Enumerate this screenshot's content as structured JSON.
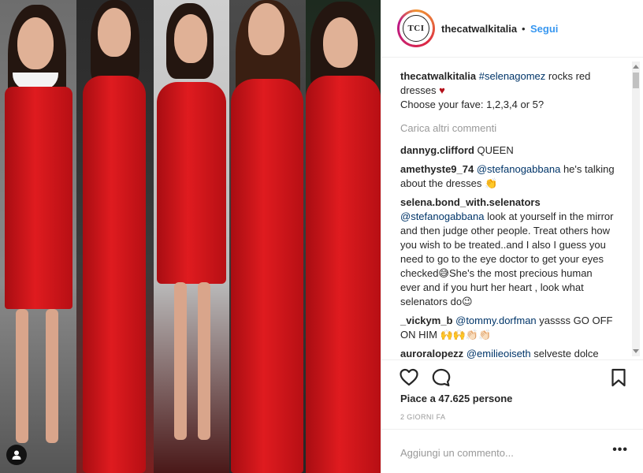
{
  "post": {
    "username": "thecatwalkitalia",
    "separator": "•",
    "follow_label": "Segui",
    "avatar_text": "TCI"
  },
  "caption": {
    "username": "thecatwalkitalia",
    "hashtag": "#selenagomez",
    "text_part1": "rocks red dresses",
    "heart": "♥",
    "text_part2": "Choose your fave: 1,2,3,4 or 5?"
  },
  "load_more_label": "Carica altri commenti",
  "comments": [
    {
      "user": "dannyg.clifford",
      "mention": "",
      "text": "QUEEN"
    },
    {
      "user": "amethyste9_74",
      "mention": "@stefanogabbana",
      "text": "he's talking about the dresses 👏"
    },
    {
      "user": "selena.bond_with.selenators",
      "mention": "@stefanogabbana",
      "text": "look at yourself in the mirror and then judge other people. Treat others how you wish to be treated..and I also I guess you need to go to the eye doctor to get your eyes checked😅She's the most precious human ever and if you hurt her heart , look what selenators do😉"
    },
    {
      "user": "_vickym_b",
      "mention": "@tommy.dorfman",
      "text": "yassss GO OFF ON HIM 🙌🙌👏🏻👏🏻"
    },
    {
      "user": "auroralopezz",
      "mention": "@emilieoiseth",
      "text": "selveste dolce"
    }
  ],
  "likes_label": "Piace a 47.625 persone",
  "timestamp": "2 GIORNI FA",
  "comment_placeholder": "Aggiungi un commento...",
  "more_label": "•••",
  "icons": {
    "like": "heart-outline-icon",
    "comment": "speech-bubble-icon",
    "save": "bookmark-icon",
    "tag": "user-tag-icon"
  },
  "colors": {
    "link_blue": "#3897f0",
    "hashtag": "#003569",
    "muted": "#999999",
    "dress_red": "#d71a1f"
  }
}
